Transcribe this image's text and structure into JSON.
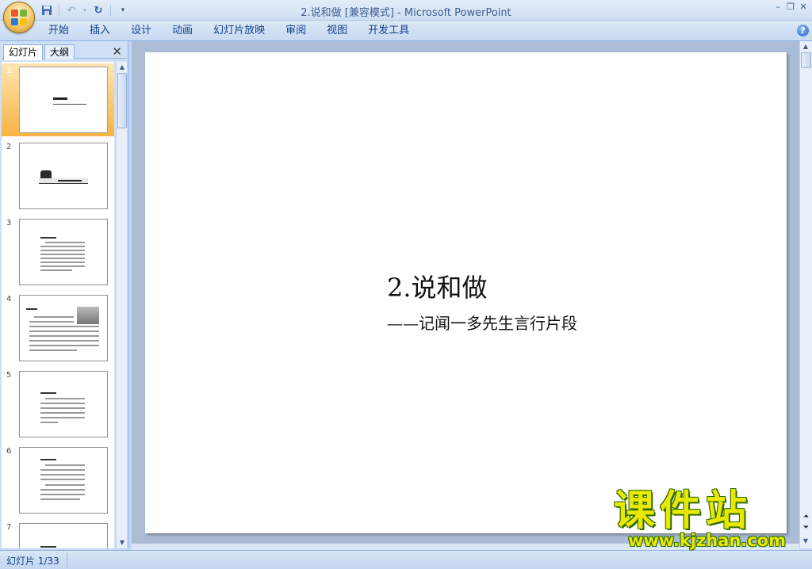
{
  "window": {
    "title": "2.说和做 [兼容模式] - Microsoft PowerPoint"
  },
  "quick_access": [
    {
      "icon": "save-icon"
    },
    {
      "icon": "undo-icon"
    },
    {
      "icon": "redo-icon"
    },
    {
      "icon": "customize-icon"
    }
  ],
  "ribbon": {
    "tabs": [
      "开始",
      "插入",
      "设计",
      "动画",
      "幻灯片放映",
      "审阅",
      "视图",
      "开发工具"
    ]
  },
  "panel": {
    "tabs": [
      "幻灯片",
      "大纲"
    ],
    "close_glyph": "✕",
    "slides": [
      {
        "number": "1"
      },
      {
        "number": "2"
      },
      {
        "number": "3"
      },
      {
        "number": "4"
      },
      {
        "number": "5"
      },
      {
        "number": "6"
      },
      {
        "number": "7"
      }
    ]
  },
  "slide": {
    "title": "2.说和做",
    "subtitle": "——记闻一多先生言行片段"
  },
  "status": {
    "slide_info": "幻灯片 1/33"
  },
  "watermark": {
    "text": "课件站",
    "url": "www.kjzhan.com"
  }
}
